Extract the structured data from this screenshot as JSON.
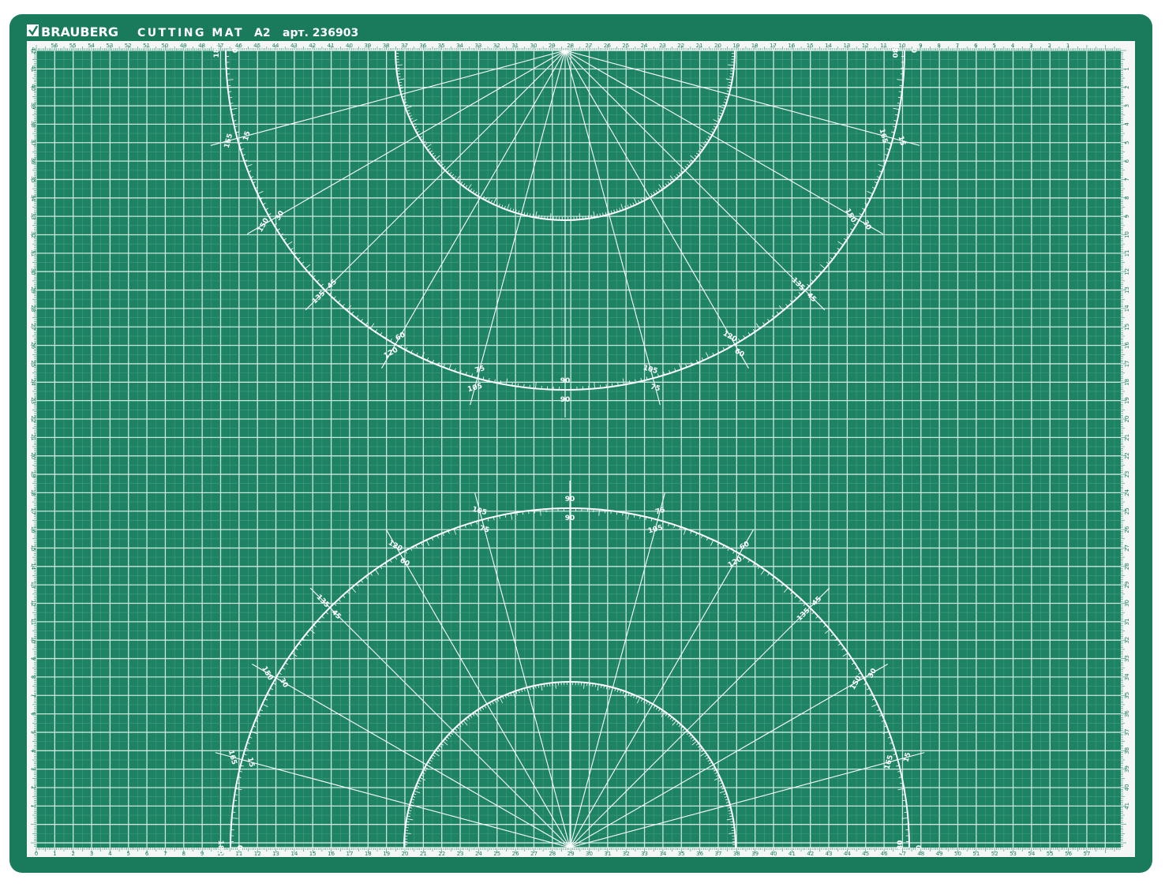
{
  "colors": {
    "mat_green": "#1e8364",
    "border_green": "#1a7a5c",
    "ruler_white": "#f4f7f5",
    "line_white": "#ffffff",
    "grid_line": "#cfe7de"
  },
  "header": {
    "logo_icon": "checkmark-logo",
    "brand": "BRAUBERG",
    "product": "CUTTING MAT",
    "size": "A2",
    "article": "арт. 236903"
  },
  "rulers": {
    "top_labels": [
      "56",
      "55",
      "54",
      "53",
      "52",
      "51",
      "50",
      "49",
      "48",
      "47",
      "46",
      "45",
      "44",
      "43",
      "42",
      "41",
      "40",
      "39",
      "38",
      "37",
      "36",
      "35",
      "34",
      "33",
      "32",
      "31",
      "30",
      "29",
      "28",
      "27",
      "26",
      "25",
      "24",
      "23",
      "22",
      "21",
      "20",
      "19",
      "18",
      "17",
      "16",
      "15",
      "14",
      "13",
      "12",
      "11",
      "10",
      "9",
      "8",
      "7",
      "6",
      "5",
      "4",
      "3",
      "2",
      "1"
    ],
    "bottom_labels": [
      "0",
      "1",
      "2",
      "3",
      "4",
      "5",
      "6",
      "7",
      "8",
      "9",
      "10",
      "11",
      "12",
      "13",
      "14",
      "15",
      "16",
      "17",
      "18",
      "19",
      "20",
      "21",
      "22",
      "23",
      "24",
      "25",
      "26",
      "27",
      "28",
      "29",
      "30",
      "31",
      "32",
      "33",
      "34",
      "35",
      "36",
      "37",
      "38",
      "39",
      "40",
      "41",
      "42",
      "43",
      "44",
      "45",
      "46",
      "47",
      "48",
      "49",
      "50",
      "51",
      "52",
      "53",
      "54",
      "55",
      "56",
      "57"
    ],
    "left_labels": [
      "42",
      "41",
      "40",
      "39",
      "38",
      "37",
      "36",
      "35",
      "34",
      "33",
      "32",
      "31",
      "30",
      "29",
      "28",
      "27",
      "26",
      "25",
      "24",
      "23",
      "22",
      "21",
      "20",
      "19",
      "18",
      "17",
      "16",
      "15",
      "14",
      "13",
      "12",
      "11",
      "10",
      "9",
      "8",
      "7",
      "6",
      "5",
      "4",
      "3",
      "2",
      "1"
    ],
    "right_labels": [
      "1",
      "2",
      "3",
      "4",
      "5",
      "6",
      "7",
      "8",
      "9",
      "10",
      "11",
      "12",
      "13",
      "14",
      "15",
      "16",
      "17",
      "18",
      "19",
      "20",
      "21",
      "22",
      "23",
      "24",
      "25",
      "26",
      "27",
      "28",
      "29",
      "30",
      "31",
      "32",
      "33",
      "34",
      "35",
      "36",
      "37",
      "38",
      "39",
      "40",
      "41"
    ]
  },
  "protractor_labels": {
    "top_outer": [
      "0",
      "15",
      "30",
      "45",
      "60",
      "75",
      "90",
      "105",
      "120",
      "135",
      "150",
      "165",
      "180"
    ],
    "top_inner": [
      "180",
      "165",
      "150",
      "135",
      "120",
      "105",
      "90",
      "75",
      "60",
      "45",
      "30",
      "15",
      "0"
    ],
    "bottom_outer": [
      "0",
      "15",
      "30",
      "45",
      "60",
      "75",
      "90",
      "105",
      "120",
      "135",
      "150",
      "165",
      "180"
    ],
    "bottom_inner": [
      "180",
      "165",
      "150",
      "135",
      "120",
      "105",
      "90",
      "75",
      "60",
      "45",
      "30",
      "15",
      "0"
    ]
  }
}
